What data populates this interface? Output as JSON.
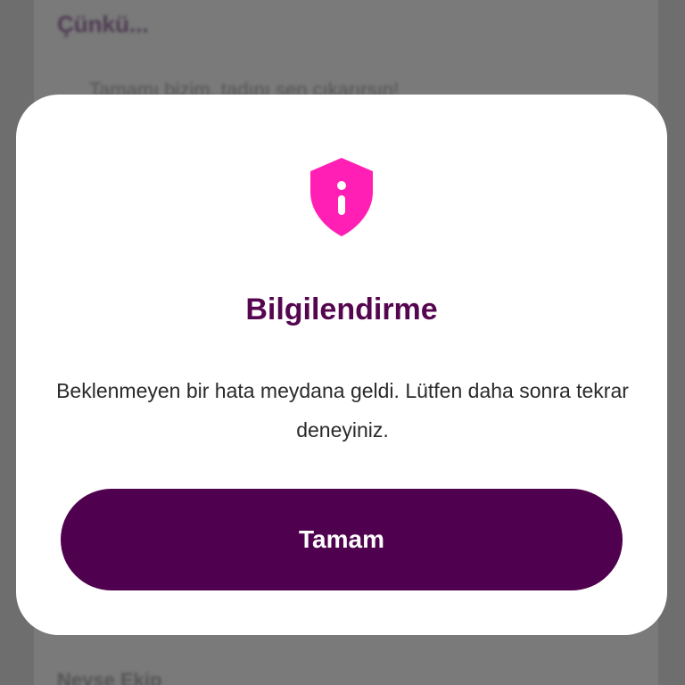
{
  "background": {
    "heading": "Çünkü...",
    "line": "Tamamı bizim, tadını sen çıkarırsın!",
    "footer": "Neyse Ekip"
  },
  "dialog": {
    "icon": "shield-info-icon",
    "title": "Bilgilendirme",
    "message": "Beklenmeyen bir hata meydana geldi. Lütfen daha sonra tekrar deneyiniz.",
    "button_label": "Tamam"
  },
  "colors": {
    "accent_icon": "#ff1fb4",
    "title": "#55064f",
    "button": "#4f004e",
    "overlay": "#6e6e6e"
  }
}
